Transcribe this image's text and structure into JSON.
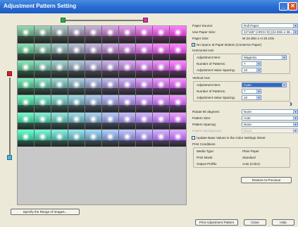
{
  "window": {
    "title": "Adjustment Pattern Setting",
    "minimize_glyph": "_",
    "close_glyph": "✕"
  },
  "preview": {
    "specify_button": "Specify the Range of Images...",
    "rows": 7,
    "cols": 10
  },
  "settings": {
    "paper_source": {
      "label": "Paper Source:",
      "value": "Roll Paper"
    },
    "use_paper_size": {
      "label": "Use Paper Size:",
      "value": "24\"x36\" (ARCH D) (24.00in x 36...."
    },
    "paper_size": {
      "label": "Paper Size:",
      "value": "W 24.00in x H 20.10in"
    },
    "no_space": {
      "label": "No Space at Paper Bottom (Conserve Paper)",
      "checked": true
    },
    "horizontal_axis": {
      "title": "Horizontal Axis",
      "adjustment_item": {
        "label": "Adjustment Item:",
        "value": "Magenta"
      },
      "number_of_patterns": {
        "label": "Number of Patterns:",
        "value": "7"
      },
      "value_spacing": {
        "label": "Adjustment Value Spacing:",
        "value": "10"
      }
    },
    "vertical_axis": {
      "title": "Vertical Axis",
      "adjustment_item": {
        "label": "Adjustment Item:",
        "value": "Cyan"
      },
      "number_of_patterns": {
        "label": "Number of Patterns:",
        "value": "7"
      },
      "value_spacing": {
        "label": "Adjustment Value Spacing:",
        "value": "10"
      }
    },
    "rotate": {
      "label": "Rotate 90 degrees:",
      "value": "None"
    },
    "pattern_size": {
      "label": "Pattern Size:",
      "value": "Auto"
    },
    "pattern_spacing": {
      "label": "Pattern Spacing:",
      "value": "None"
    },
    "pattern_background": {
      "label": "Pattern Background:",
      "value": "Black"
    },
    "update_base": {
      "label": "Update Base Values in the Color Settings Sheet",
      "checked": false
    },
    "print_conditions": {
      "title": "Print Conditions",
      "media_type": {
        "label": "Media Type:",
        "value": "Plain Paper"
      },
      "print_mode": {
        "label": "Print Mode:",
        "value": "Standard"
      },
      "output_profile": {
        "label": "Output Profile:",
        "value": "Auto (Color)"
      }
    },
    "restore_button": "Restore to Previous"
  },
  "footer": {
    "print_button": "Print Adjustment Pattern",
    "close_button": "Close",
    "help_button": "Help"
  },
  "colors": {
    "title_bar": "#2a6fd4",
    "green_marker": "#2fa84f",
    "magenta_marker": "#c43aa0",
    "red_marker": "#d42424",
    "cyan_marker": "#49b8d6"
  }
}
